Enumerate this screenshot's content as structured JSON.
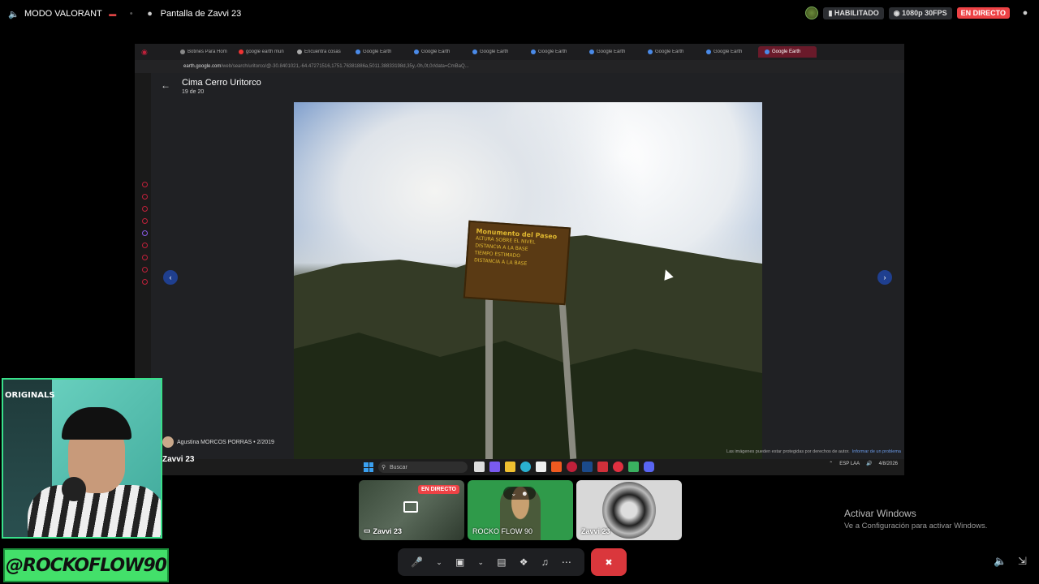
{
  "discord": {
    "mode_label": "MODO VALORANT",
    "share_label": "Pantalla de Zavvi 23",
    "enabled_label": "HABILITADO",
    "quality_label": "1080p 30FPS",
    "live_label": "EN DIRECTO"
  },
  "browser": {
    "tabs": [
      "Botines Para Hom",
      "google earth mun",
      "Encuentra cosas",
      "Google Earth",
      "Google Earth",
      "Google Earth",
      "Google Earth",
      "Google Earth",
      "Google Earth",
      "Google Earth",
      "Google Earth"
    ],
    "url_host": "earth.google.com",
    "url_rest": "/web/search/uritorco/@-30.8401021,-64.47271516,1751.76381886a,5011.38833198d,35y,-0h,0t,0r/data=CmBaQ..."
  },
  "photo": {
    "title": "Cima Cerro Uritorco",
    "counter": "19 de 20",
    "author": "Agustina MORCOS PORRAS • 2/2019",
    "sign_lines": [
      "Monumento del Paseo",
      "ALTURA SOBRE EL NIVEL",
      "DISTANCIA A LA BASE",
      "TIEMPO ESTIMADO",
      "DISTANCIA A LA BASE"
    ],
    "rights_text": "Las imágenes pueden estar protegidas por derechos de autor.",
    "report_link": "Informar de un problema"
  },
  "taskbar": {
    "search_placeholder": "Buscar",
    "lang": "ESP LAA",
    "date": "4/8/2026"
  },
  "stream_owner_label": "Zavvi 23",
  "webcam": {
    "poster_text": "ORIGINALS",
    "handle": "@ROCKOFLOW90"
  },
  "participants": [
    {
      "name": "Zavvi 23",
      "badge": "EN DIRECTO"
    },
    {
      "name": "ROCKO FLOW 90"
    },
    {
      "name": "Zavvi 23"
    }
  ],
  "windows_activation": {
    "line1": "Activar Windows",
    "line2": "Ve a Configuración para activar Windows."
  },
  "colors": {
    "live_red": "#ed4245",
    "hangup_red": "#da373c",
    "handle_green": "#43e06a",
    "nav_blue": "#1f3f8f"
  }
}
